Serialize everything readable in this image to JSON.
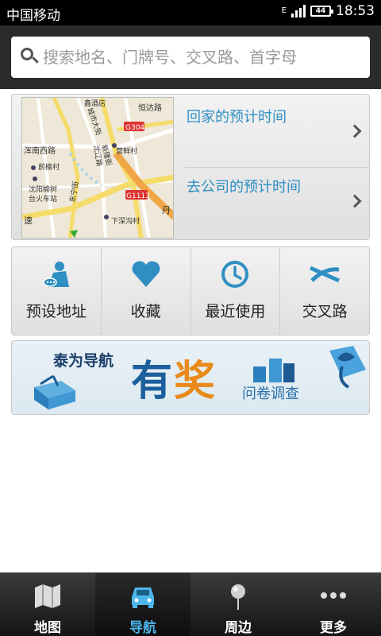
{
  "status_bar": {
    "carrier": "中国移动",
    "network": "E",
    "battery": "44",
    "time": "18:53"
  },
  "search": {
    "placeholder": "搜索地名、门牌号、交叉路、首字母"
  },
  "map_preview": {
    "labels": [
      "鑫酒店",
      "恒达路",
      "G304",
      "浑南西路",
      "营鲜村",
      "前榆村",
      "沈阳榆树",
      "台火车站",
      "G1113",
      "下深沟村",
      "丹",
      "速",
      "新隆街",
      "城市大街",
      "东宁街",
      "沈辽路"
    ]
  },
  "eta": {
    "home_label": "回家的预计时间",
    "office_label": "去公司的预计时间"
  },
  "actions": [
    {
      "label": "预设地址",
      "icon": "preset-address-icon"
    },
    {
      "label": "收藏",
      "icon": "heart-icon"
    },
    {
      "label": "最近使用",
      "icon": "clock-icon"
    },
    {
      "label": "交叉路",
      "icon": "crossroad-icon"
    }
  ],
  "banner": {
    "brand": "泰为导航",
    "headline_1": "有",
    "headline_2": "奖",
    "subtitle": "问卷调查"
  },
  "tabs": [
    {
      "label": "地图",
      "icon": "map-icon",
      "active": false
    },
    {
      "label": "导航",
      "icon": "car-icon",
      "active": true
    },
    {
      "label": "周边",
      "icon": "pin-icon",
      "active": false
    },
    {
      "label": "更多",
      "icon": "more-dots-icon",
      "active": false
    }
  ],
  "colors": {
    "accent": "#2f8fc3",
    "tab_active": "#4cb6ea",
    "banner_orange": "#e98a1b"
  }
}
